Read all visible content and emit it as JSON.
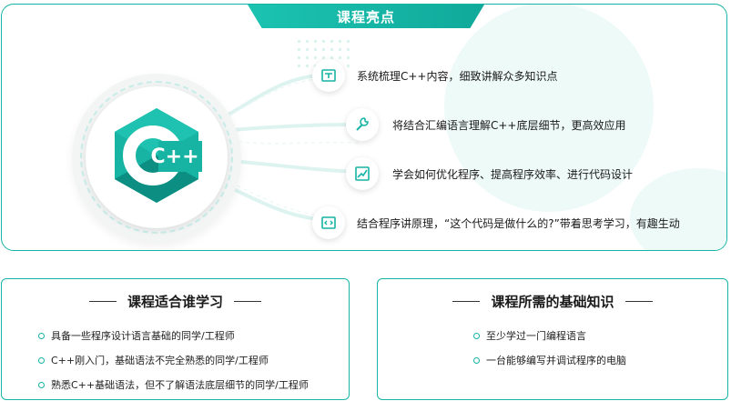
{
  "highlights": {
    "title": "课程亮点",
    "features": [
      {
        "icon": "book-icon",
        "text": "系统梳理C++内容，细致讲解众多知识点"
      },
      {
        "icon": "wrench-icon",
        "text": "将结合汇编语言理解C++底层细节，更高效应用"
      },
      {
        "icon": "chart-icon",
        "text": "学会如何优化程序、提高程序效率、进行代码设计"
      },
      {
        "icon": "code-icon",
        "text": "结合程序讲原理，“这个代码是做什么的?”带着思考学习，有趣生动"
      }
    ],
    "logo": {
      "text": "C++",
      "color": "#14a898"
    }
  },
  "audience": {
    "title": "课程适合谁学习",
    "items": [
      "具备一些程序设计语言基础的同学/工程师",
      "C++刚入门，基础语法不完全熟悉的同学/工程师",
      "熟悉C++基础语法，但不了解语法底层细节的同学/工程师"
    ]
  },
  "prerequisites": {
    "title": "课程所需的基础知识",
    "items": [
      "至少学过一门编程语言",
      "一台能够编写并调试程序的电脑"
    ]
  },
  "colors": {
    "accent": "#16b4a4",
    "accent_light": "#eefaf8"
  }
}
